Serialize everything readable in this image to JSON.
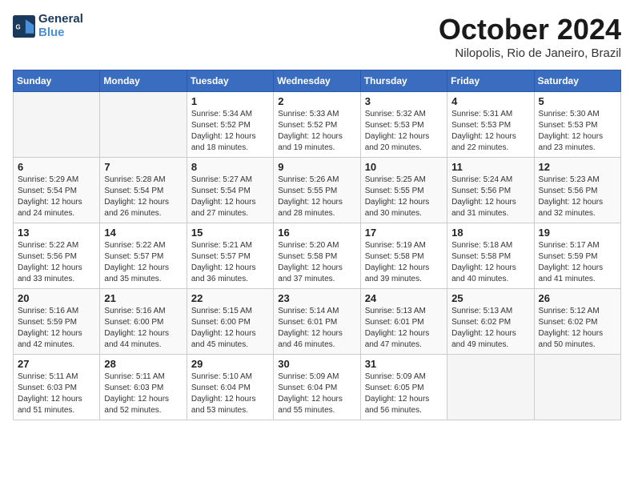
{
  "header": {
    "logo_line1": "General",
    "logo_line2": "Blue",
    "month": "October 2024",
    "location": "Nilopolis, Rio de Janeiro, Brazil"
  },
  "weekdays": [
    "Sunday",
    "Monday",
    "Tuesday",
    "Wednesday",
    "Thursday",
    "Friday",
    "Saturday"
  ],
  "weeks": [
    [
      {
        "day": "",
        "sunrise": "",
        "sunset": "",
        "daylight": ""
      },
      {
        "day": "",
        "sunrise": "",
        "sunset": "",
        "daylight": ""
      },
      {
        "day": "1",
        "sunrise": "Sunrise: 5:34 AM",
        "sunset": "Sunset: 5:52 PM",
        "daylight": "Daylight: 12 hours and 18 minutes."
      },
      {
        "day": "2",
        "sunrise": "Sunrise: 5:33 AM",
        "sunset": "Sunset: 5:52 PM",
        "daylight": "Daylight: 12 hours and 19 minutes."
      },
      {
        "day": "3",
        "sunrise": "Sunrise: 5:32 AM",
        "sunset": "Sunset: 5:53 PM",
        "daylight": "Daylight: 12 hours and 20 minutes."
      },
      {
        "day": "4",
        "sunrise": "Sunrise: 5:31 AM",
        "sunset": "Sunset: 5:53 PM",
        "daylight": "Daylight: 12 hours and 22 minutes."
      },
      {
        "day": "5",
        "sunrise": "Sunrise: 5:30 AM",
        "sunset": "Sunset: 5:53 PM",
        "daylight": "Daylight: 12 hours and 23 minutes."
      }
    ],
    [
      {
        "day": "6",
        "sunrise": "Sunrise: 5:29 AM",
        "sunset": "Sunset: 5:54 PM",
        "daylight": "Daylight: 12 hours and 24 minutes."
      },
      {
        "day": "7",
        "sunrise": "Sunrise: 5:28 AM",
        "sunset": "Sunset: 5:54 PM",
        "daylight": "Daylight: 12 hours and 26 minutes."
      },
      {
        "day": "8",
        "sunrise": "Sunrise: 5:27 AM",
        "sunset": "Sunset: 5:54 PM",
        "daylight": "Daylight: 12 hours and 27 minutes."
      },
      {
        "day": "9",
        "sunrise": "Sunrise: 5:26 AM",
        "sunset": "Sunset: 5:55 PM",
        "daylight": "Daylight: 12 hours and 28 minutes."
      },
      {
        "day": "10",
        "sunrise": "Sunrise: 5:25 AM",
        "sunset": "Sunset: 5:55 PM",
        "daylight": "Daylight: 12 hours and 30 minutes."
      },
      {
        "day": "11",
        "sunrise": "Sunrise: 5:24 AM",
        "sunset": "Sunset: 5:56 PM",
        "daylight": "Daylight: 12 hours and 31 minutes."
      },
      {
        "day": "12",
        "sunrise": "Sunrise: 5:23 AM",
        "sunset": "Sunset: 5:56 PM",
        "daylight": "Daylight: 12 hours and 32 minutes."
      }
    ],
    [
      {
        "day": "13",
        "sunrise": "Sunrise: 5:22 AM",
        "sunset": "Sunset: 5:56 PM",
        "daylight": "Daylight: 12 hours and 33 minutes."
      },
      {
        "day": "14",
        "sunrise": "Sunrise: 5:22 AM",
        "sunset": "Sunset: 5:57 PM",
        "daylight": "Daylight: 12 hours and 35 minutes."
      },
      {
        "day": "15",
        "sunrise": "Sunrise: 5:21 AM",
        "sunset": "Sunset: 5:57 PM",
        "daylight": "Daylight: 12 hours and 36 minutes."
      },
      {
        "day": "16",
        "sunrise": "Sunrise: 5:20 AM",
        "sunset": "Sunset: 5:58 PM",
        "daylight": "Daylight: 12 hours and 37 minutes."
      },
      {
        "day": "17",
        "sunrise": "Sunrise: 5:19 AM",
        "sunset": "Sunset: 5:58 PM",
        "daylight": "Daylight: 12 hours and 39 minutes."
      },
      {
        "day": "18",
        "sunrise": "Sunrise: 5:18 AM",
        "sunset": "Sunset: 5:58 PM",
        "daylight": "Daylight: 12 hours and 40 minutes."
      },
      {
        "day": "19",
        "sunrise": "Sunrise: 5:17 AM",
        "sunset": "Sunset: 5:59 PM",
        "daylight": "Daylight: 12 hours and 41 minutes."
      }
    ],
    [
      {
        "day": "20",
        "sunrise": "Sunrise: 5:16 AM",
        "sunset": "Sunset: 5:59 PM",
        "daylight": "Daylight: 12 hours and 42 minutes."
      },
      {
        "day": "21",
        "sunrise": "Sunrise: 5:16 AM",
        "sunset": "Sunset: 6:00 PM",
        "daylight": "Daylight: 12 hours and 44 minutes."
      },
      {
        "day": "22",
        "sunrise": "Sunrise: 5:15 AM",
        "sunset": "Sunset: 6:00 PM",
        "daylight": "Daylight: 12 hours and 45 minutes."
      },
      {
        "day": "23",
        "sunrise": "Sunrise: 5:14 AM",
        "sunset": "Sunset: 6:01 PM",
        "daylight": "Daylight: 12 hours and 46 minutes."
      },
      {
        "day": "24",
        "sunrise": "Sunrise: 5:13 AM",
        "sunset": "Sunset: 6:01 PM",
        "daylight": "Daylight: 12 hours and 47 minutes."
      },
      {
        "day": "25",
        "sunrise": "Sunrise: 5:13 AM",
        "sunset": "Sunset: 6:02 PM",
        "daylight": "Daylight: 12 hours and 49 minutes."
      },
      {
        "day": "26",
        "sunrise": "Sunrise: 5:12 AM",
        "sunset": "Sunset: 6:02 PM",
        "daylight": "Daylight: 12 hours and 50 minutes."
      }
    ],
    [
      {
        "day": "27",
        "sunrise": "Sunrise: 5:11 AM",
        "sunset": "Sunset: 6:03 PM",
        "daylight": "Daylight: 12 hours and 51 minutes."
      },
      {
        "day": "28",
        "sunrise": "Sunrise: 5:11 AM",
        "sunset": "Sunset: 6:03 PM",
        "daylight": "Daylight: 12 hours and 52 minutes."
      },
      {
        "day": "29",
        "sunrise": "Sunrise: 5:10 AM",
        "sunset": "Sunset: 6:04 PM",
        "daylight": "Daylight: 12 hours and 53 minutes."
      },
      {
        "day": "30",
        "sunrise": "Sunrise: 5:09 AM",
        "sunset": "Sunset: 6:04 PM",
        "daylight": "Daylight: 12 hours and 55 minutes."
      },
      {
        "day": "31",
        "sunrise": "Sunrise: 5:09 AM",
        "sunset": "Sunset: 6:05 PM",
        "daylight": "Daylight: 12 hours and 56 minutes."
      },
      {
        "day": "",
        "sunrise": "",
        "sunset": "",
        "daylight": ""
      },
      {
        "day": "",
        "sunrise": "",
        "sunset": "",
        "daylight": ""
      }
    ]
  ]
}
